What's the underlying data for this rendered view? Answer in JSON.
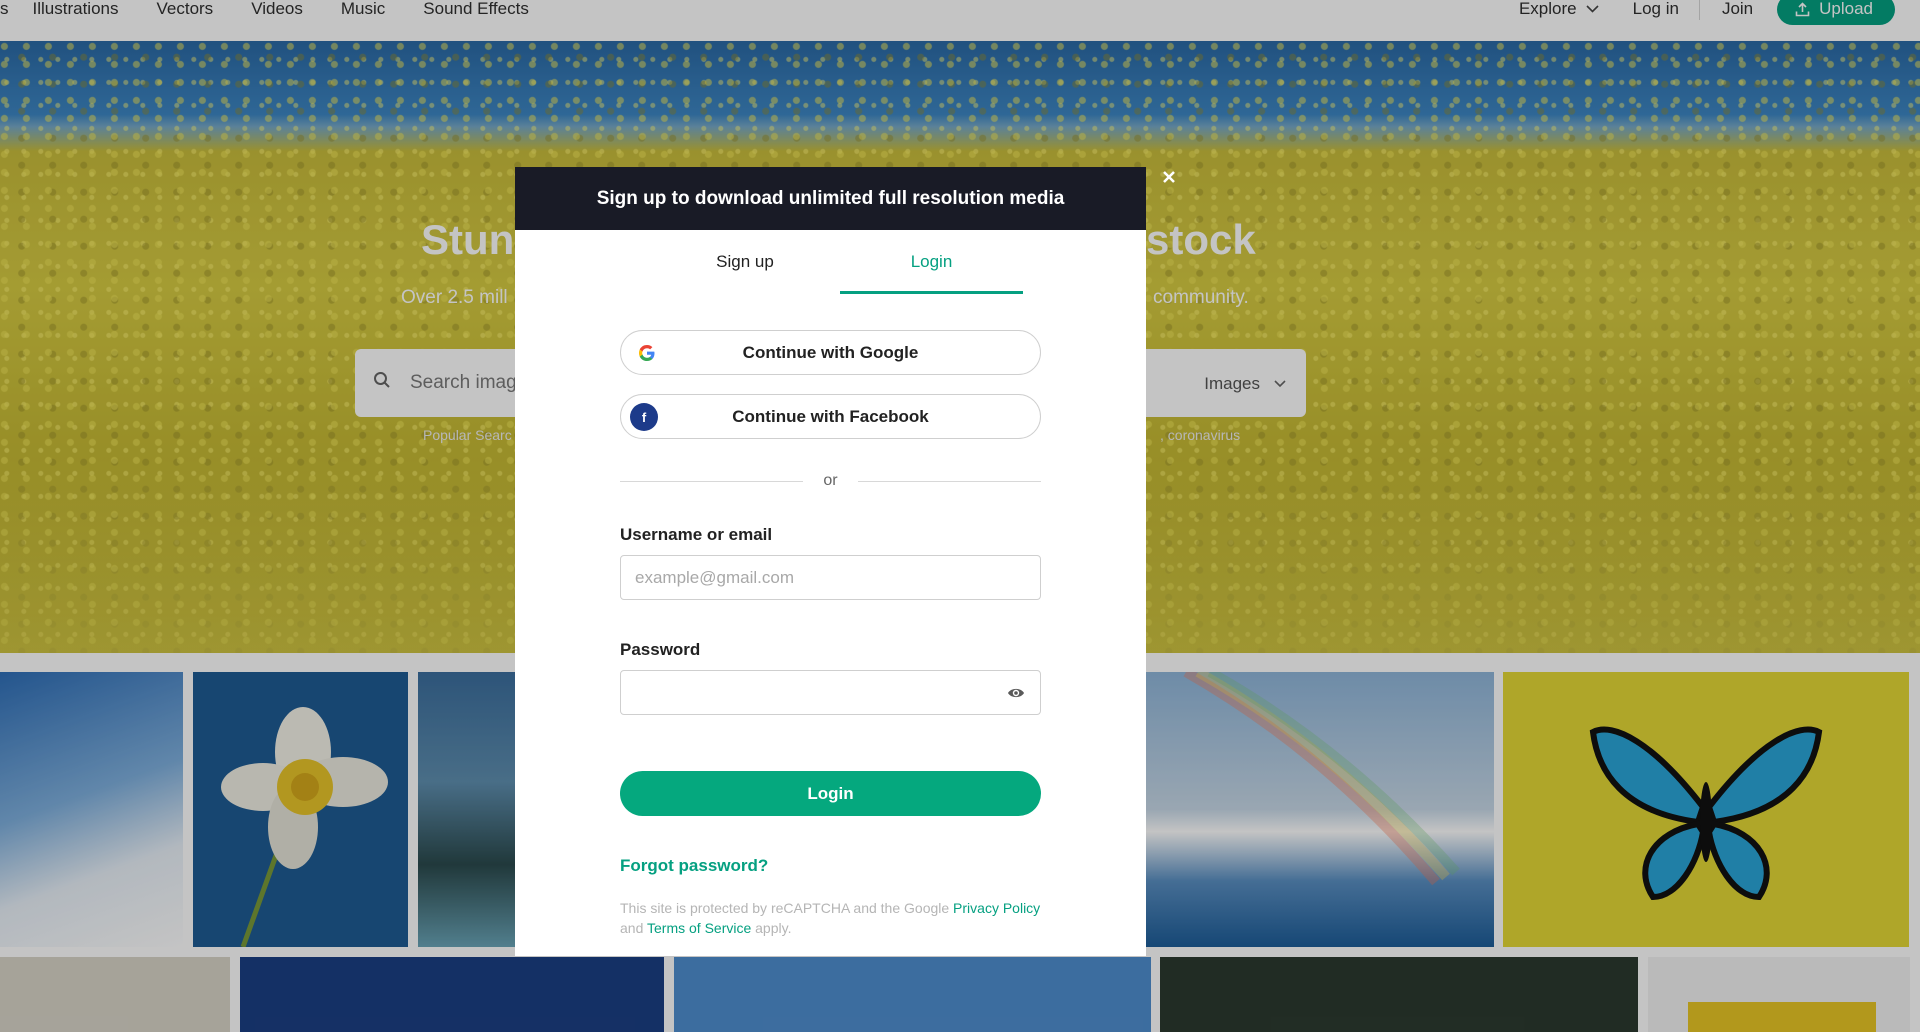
{
  "nav": {
    "items": [
      "s",
      "Illustrations",
      "Vectors",
      "Videos",
      "Music",
      "Sound Effects"
    ],
    "explore": "Explore",
    "login": "Log in",
    "join": "Join",
    "upload": "Upload"
  },
  "hero": {
    "title_left": "Stun",
    "title_right": "stock",
    "subtitle_left": "Over 2.5 mill",
    "subtitle_right": "community.",
    "search_placeholder": "Search imag",
    "search_type": "Images",
    "popular_label": "Popular Searc",
    "popular_tail": ", coronavirus"
  },
  "modal": {
    "title": "Sign up to download unlimited full resolution media",
    "tabs": {
      "signup": "Sign up",
      "login": "Login"
    },
    "google": "Continue with Google",
    "facebook": "Continue with Facebook",
    "or": "or",
    "username_label": "Username or email",
    "username_placeholder": "example@gmail.com",
    "password_label": "Password",
    "login_button": "Login",
    "forgot": "Forgot password?",
    "legal": {
      "pre": "This site is protected by reCAPTCHA and the Google ",
      "privacy": "Privacy Policy",
      "and": " and ",
      "terms": "Terms of Service",
      "post": " apply."
    }
  },
  "colors": {
    "accent": "#05a081",
    "modal_header": "#191b26",
    "facebook": "#1d3b8a"
  },
  "icons": [
    "chevron-down-icon",
    "upload-icon",
    "search-icon",
    "close-icon",
    "google-icon",
    "facebook-icon",
    "eye-icon"
  ]
}
